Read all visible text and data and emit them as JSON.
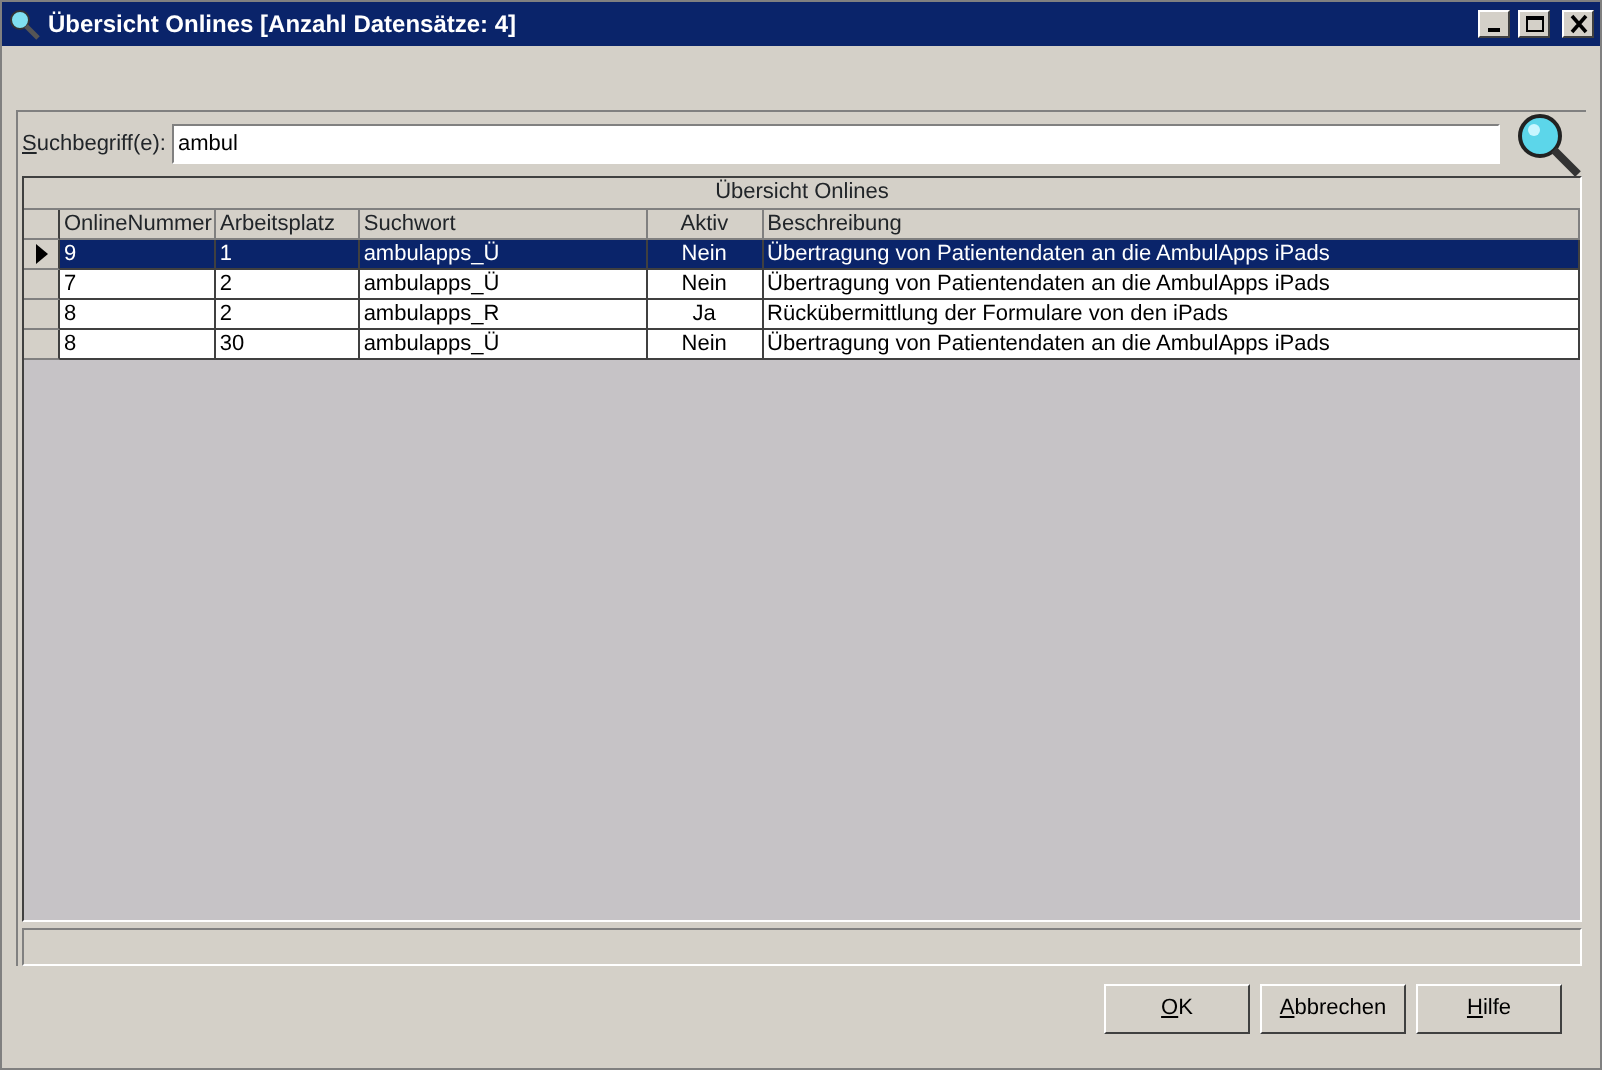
{
  "window": {
    "title": "Übersicht Onlines [Anzahl Datensätze: 4]"
  },
  "search": {
    "label": "Suchbegriff(e):",
    "value": "ambul"
  },
  "table": {
    "title": "Übersicht Onlines",
    "columns": [
      {
        "label": "OnlineNummer",
        "kind": "text"
      },
      {
        "label": "Arbeitsplatz",
        "kind": "text"
      },
      {
        "label": "Suchwort",
        "kind": "text"
      },
      {
        "label": "Aktiv",
        "kind": "flag"
      },
      {
        "label": "Beschreibung",
        "kind": "text"
      }
    ],
    "rows": [
      {
        "selected": true,
        "cells": [
          "9",
          "1",
          "ambulapps_Ü",
          "Nein",
          "Übertragung von Patientendaten an die AmbulApps iPads"
        ]
      },
      {
        "selected": false,
        "cells": [
          "7",
          "2",
          "ambulapps_Ü",
          "Nein",
          "Übertragung von Patientendaten an die AmbulApps iPads"
        ]
      },
      {
        "selected": false,
        "cells": [
          "8",
          "2",
          "ambulapps_R",
          "Ja",
          "Rückübermittlung der Formulare von den iPads"
        ]
      },
      {
        "selected": false,
        "cells": [
          "8",
          "30",
          "ambulapps_Ü",
          "Nein",
          "Übertragung von Patientendaten an die AmbulApps iPads"
        ]
      }
    ]
  },
  "buttons": [
    "OK",
    "Abbrechen",
    "Hilfe"
  ]
}
